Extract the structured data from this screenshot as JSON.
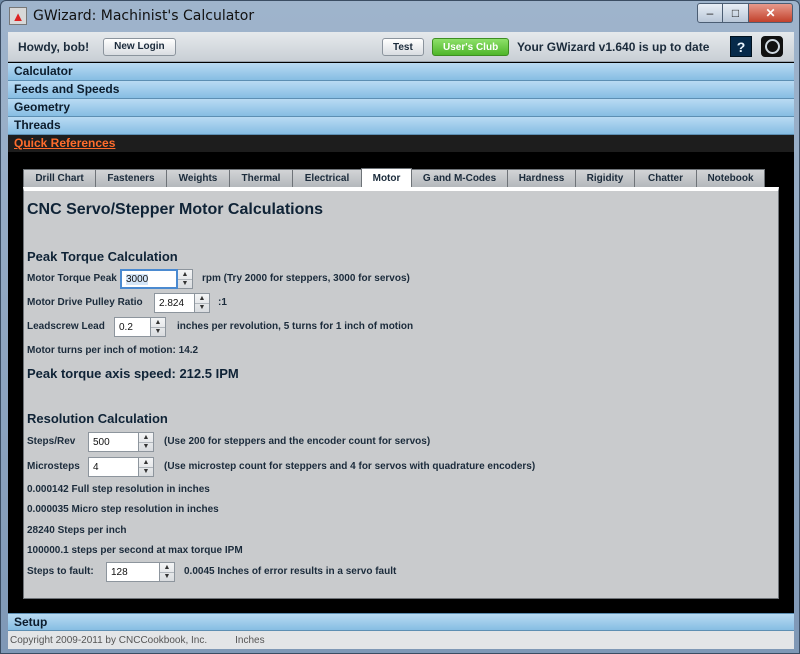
{
  "window": {
    "title": "GWizard: Machinist's Calculator",
    "min_glyph": "–",
    "max_glyph": "□",
    "close_glyph": "✕",
    "app_glyph": "▲"
  },
  "topbar": {
    "greeting": "Howdy, bob!",
    "new_login": "New Login",
    "test": "Test",
    "users_club": "User's Club",
    "version_text": "Your GWizard v1.640 is up to date",
    "help_glyph": "?"
  },
  "accordion": [
    "Calculator",
    "Feeds and Speeds",
    "Geometry",
    "Threads",
    "Quick References"
  ],
  "tabs": [
    "Drill Chart",
    "Fasteners",
    "Weights",
    "Thermal",
    "Electrical",
    "Motor",
    "G and M-Codes",
    "Hardness",
    "Rigidity",
    "Chatter",
    "Notebook"
  ],
  "panel": {
    "title": "CNC Servo/Stepper Motor Calculations",
    "peak": {
      "heading": "Peak Torque Calculation",
      "motor_torque_label": "Motor Torque Peak",
      "motor_torque_value": "3000",
      "motor_torque_note": "rpm (Try 2000 for steppers, 3000 for servos)",
      "pulley_label": "Motor Drive Pulley Ratio",
      "pulley_value": "2.824",
      "pulley_note": ":1",
      "lead_label": "Leadscrew Lead",
      "lead_value": "0.2",
      "lead_note": "inches per revolution, 5 turns for 1 inch of motion",
      "turns_text": "Motor turns per inch of motion: 14.2",
      "result": "Peak torque axis speed: 212.5 IPM"
    },
    "resolution": {
      "heading": "Resolution Calculation",
      "steps_label": "Steps/Rev",
      "steps_value": "500",
      "steps_note": "(Use 200 for steppers and the encoder count for servos)",
      "micro_label": "Microsteps",
      "micro_value": "4",
      "micro_note": "(Use microstep count for steppers and 4 for servos with quadrature encoders)",
      "full_step": "0.000142 Full step resolution in inches",
      "micro_step": "0.000035 Micro step resolution in inches",
      "steps_inch": "28240 Steps per inch",
      "steps_sec": "100000.1 steps per second at max torque IPM",
      "fault_label": "Steps to fault:",
      "fault_value": "128",
      "fault_note": "0.0045 Inches of error results in a servo fault"
    }
  },
  "bottom": {
    "setup": "Setup",
    "copyright": "Copyright 2009-2011 by CNCCookbook, Inc.",
    "units": "Inches"
  }
}
